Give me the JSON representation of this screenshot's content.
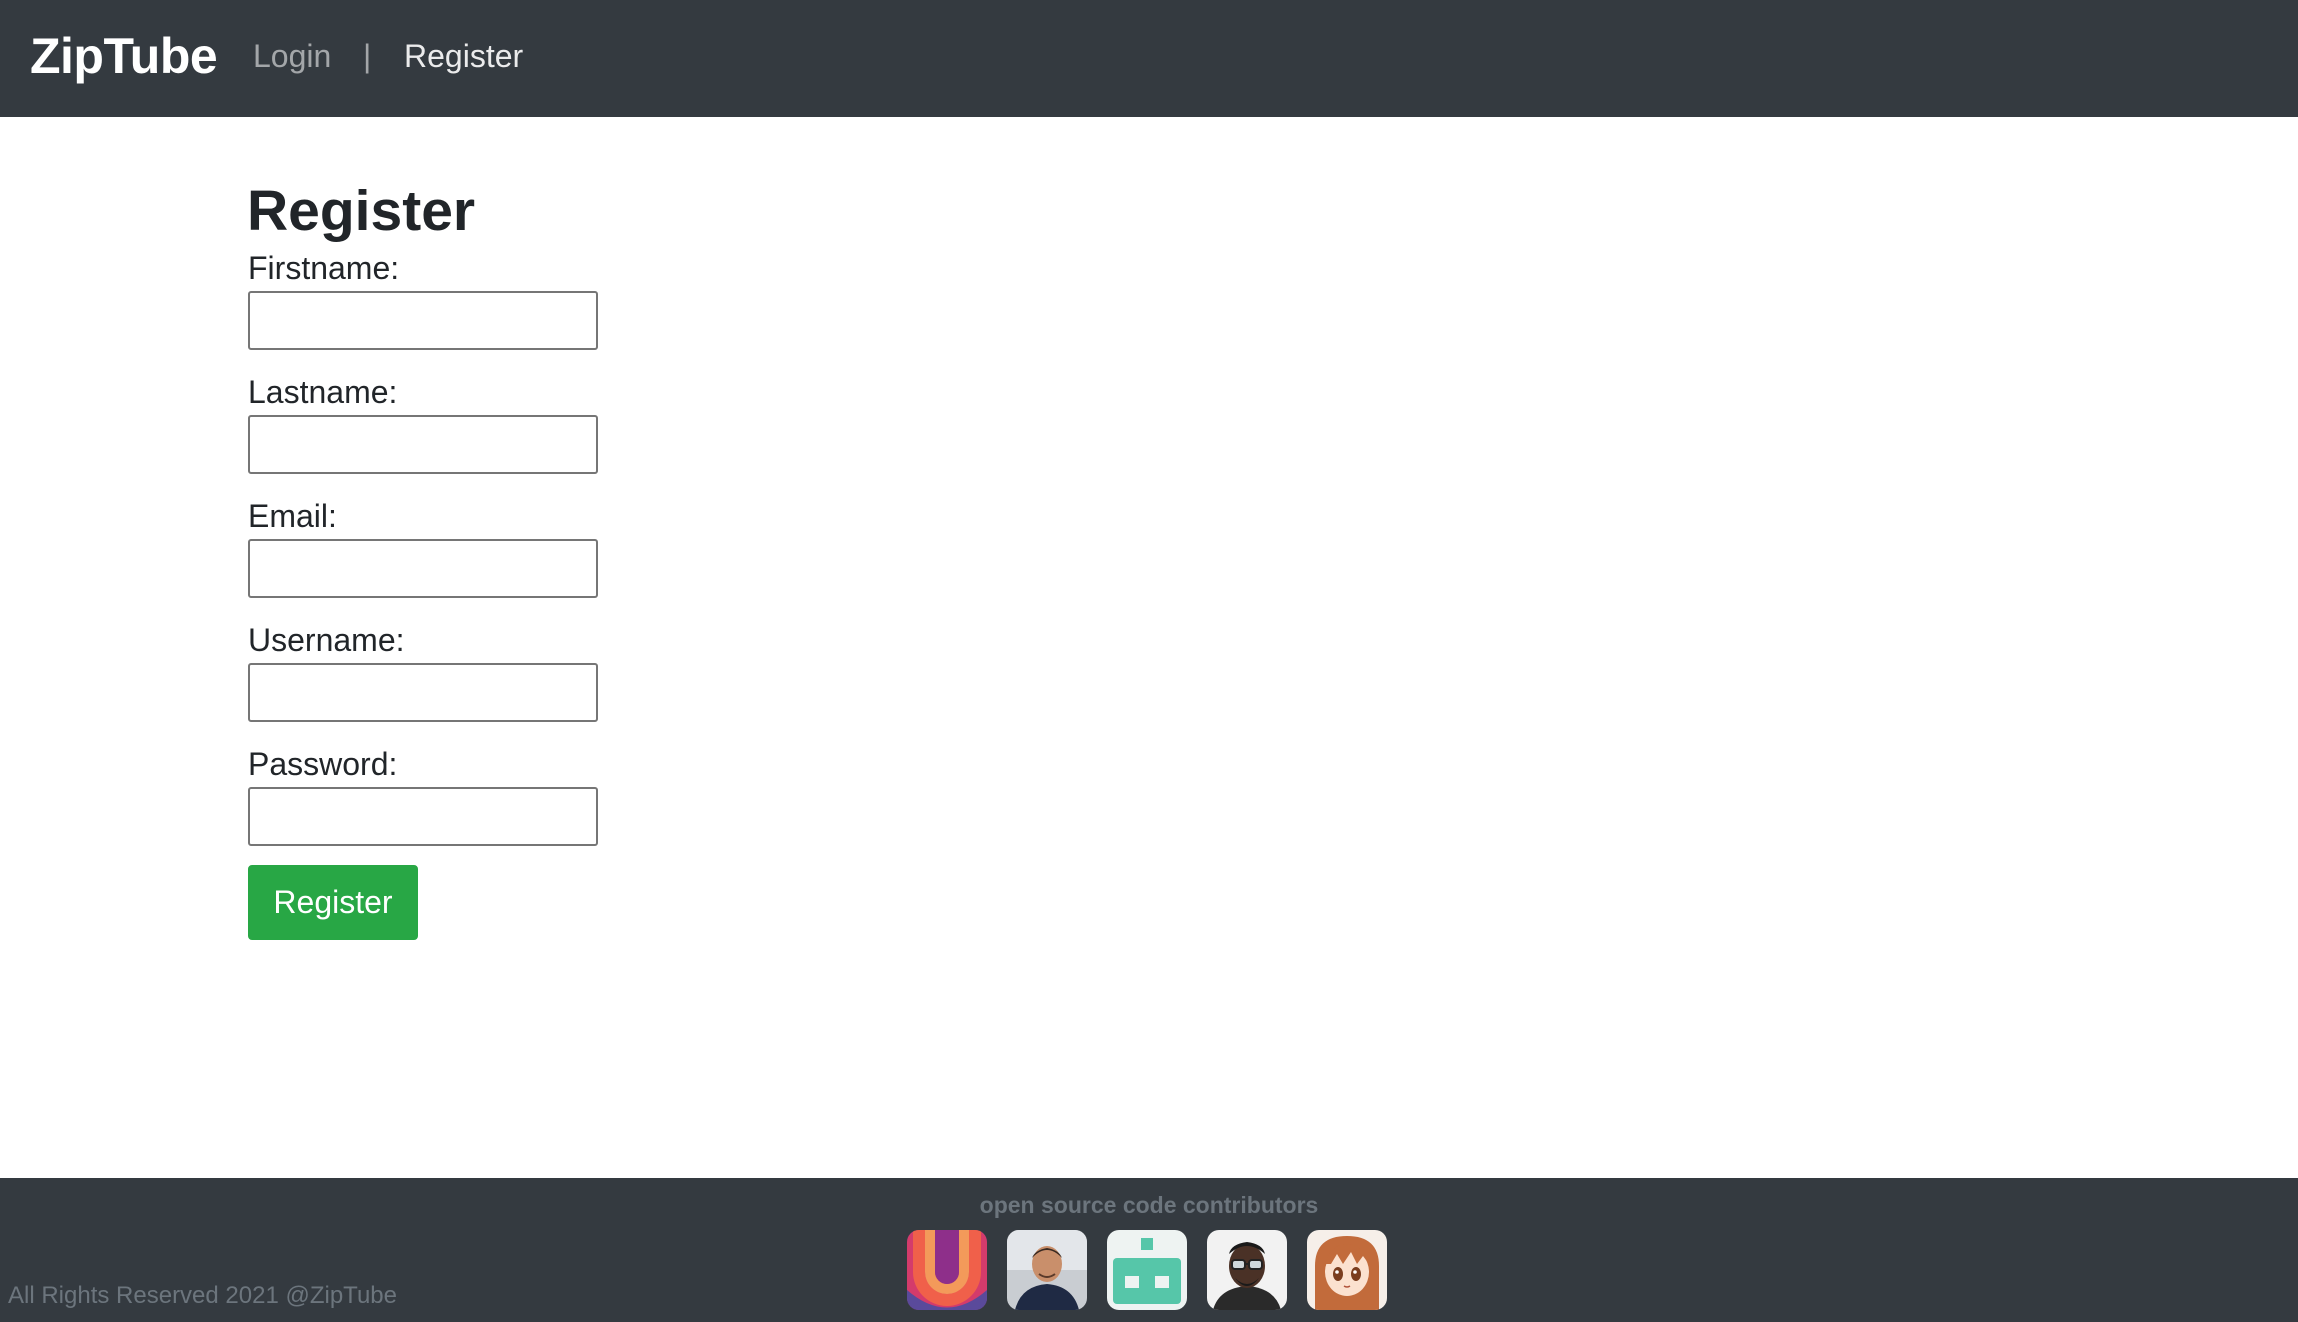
{
  "navbar": {
    "brand": "ZipTube",
    "login_label": "Login",
    "separator": "|",
    "register_label": "Register"
  },
  "form": {
    "title": "Register",
    "fields": [
      {
        "label": "Firstname:",
        "value": "",
        "placeholder": ""
      },
      {
        "label": "Lastname:",
        "value": "",
        "placeholder": ""
      },
      {
        "label": "Email:",
        "value": "",
        "placeholder": ""
      },
      {
        "label": "Username:",
        "value": "",
        "placeholder": ""
      },
      {
        "label": "Password:",
        "value": "",
        "placeholder": ""
      }
    ],
    "submit_label": "Register"
  },
  "footer": {
    "heading": "open source code contributors",
    "contributors": [
      {
        "icon": "abstract-wave-avatar"
      },
      {
        "icon": "person-photo-avatar"
      },
      {
        "icon": "robot-identicon-avatar"
      },
      {
        "icon": "person-glasses-photo-avatar"
      },
      {
        "icon": "anime-character-avatar"
      }
    ],
    "copyright": "All Rights Reserved 2021 @ZipTube"
  },
  "colors": {
    "navbar_bg": "#343a40",
    "submit_bg": "#28a745",
    "muted_text": "#6c757d"
  }
}
